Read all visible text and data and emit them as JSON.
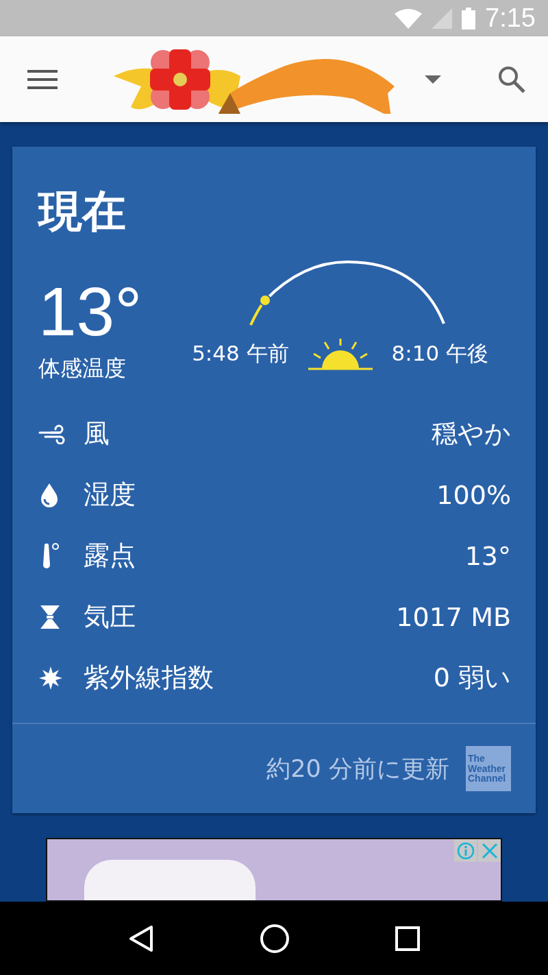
{
  "status_bar": {
    "time": "7:15"
  },
  "card": {
    "title": "現在",
    "temperature": "13°",
    "feels_like_label": "体感温度",
    "sunrise": "5:48 午前",
    "sunset": "8:10 午後",
    "details": [
      {
        "kind": "wind",
        "label": "風",
        "value": "穏やか"
      },
      {
        "kind": "humidity",
        "label": "湿度",
        "value": "100%"
      },
      {
        "kind": "dew_point",
        "label": "露点",
        "value": "13°"
      },
      {
        "kind": "pressure",
        "label": "気圧",
        "value": "1017 MB"
      },
      {
        "kind": "uv",
        "label": "紫外線指数",
        "value": "0 弱い"
      }
    ],
    "updated": "約20 分前に更新",
    "provider_logo": [
      "The",
      "Weather",
      "Channel"
    ]
  }
}
